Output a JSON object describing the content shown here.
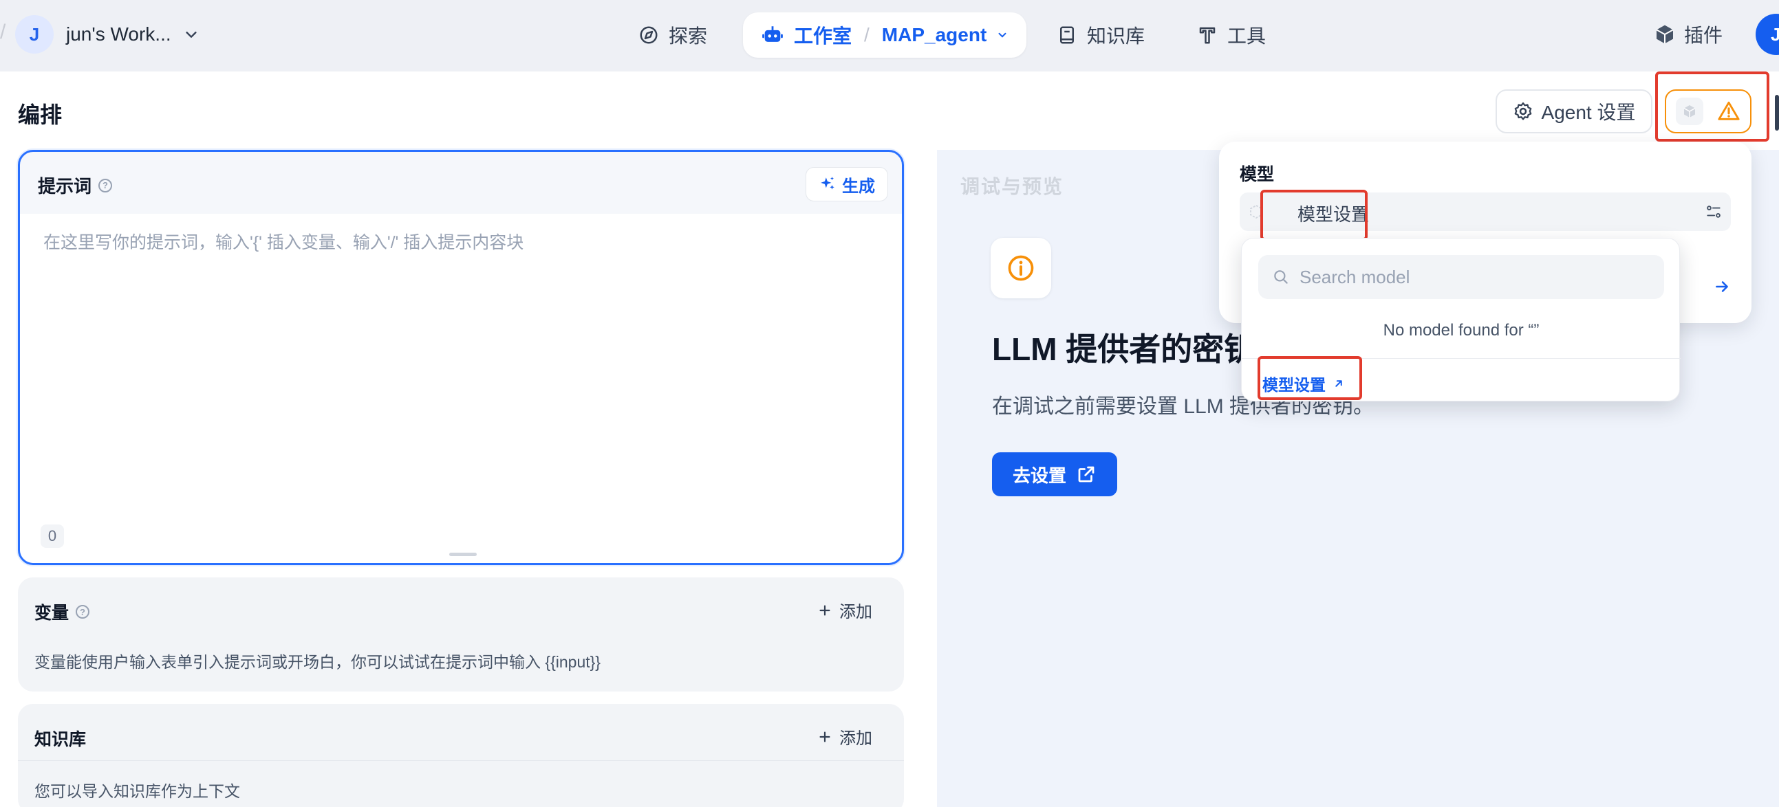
{
  "workspace": {
    "avatar_letter": "J",
    "name": "jun's Work..."
  },
  "nav": {
    "explore": "探索",
    "studio": "工作室",
    "separator": "/",
    "app_name": "MAP_agent",
    "knowledge": "知识库",
    "tools": "工具",
    "plugins": "插件",
    "user_avatar_letter": "J"
  },
  "header": {
    "title": "编排",
    "agent_settings_label": "Agent 设置"
  },
  "prompt": {
    "title": "提示词",
    "generate_label": "生成",
    "placeholder": "在这里写你的提示词，输入'{' 插入变量、输入'/' 插入提示内容块",
    "char_count": "0"
  },
  "variables": {
    "title": "变量",
    "add_label": "添加",
    "description": "变量能使用户输入表单引入提示词或开场白，你可以试试在提示词中输入 {{input}}"
  },
  "knowledge": {
    "title": "知识库",
    "add_label": "添加",
    "description": "您可以导入知识库作为上下文"
  },
  "debug_panel": {
    "faded_title": "调试与预览",
    "llm_title": "LLM 提供者的密钥",
    "llm_desc": "在调试之前需要设置 LLM 提供者的密钥。",
    "go_settings_label": "去设置"
  },
  "model_popover": {
    "title": "模型",
    "select_label": "模型设置"
  },
  "model_dropdown": {
    "search_placeholder": "Search model",
    "empty_text": "No model found for “”",
    "settings_link": "模型设置"
  },
  "colors": {
    "accent": "#155eef",
    "warning": "#f79009",
    "highlight_box": "#e23b2d"
  }
}
